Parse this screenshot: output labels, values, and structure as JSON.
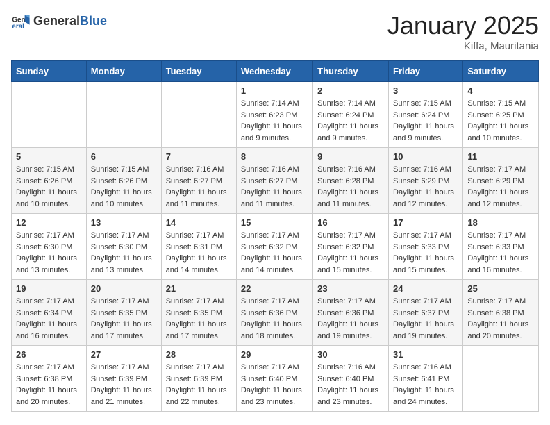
{
  "header": {
    "logo_general": "General",
    "logo_blue": "Blue",
    "month_title": "January 2025",
    "location": "Kiffa, Mauritania"
  },
  "days_of_week": [
    "Sunday",
    "Monday",
    "Tuesday",
    "Wednesday",
    "Thursday",
    "Friday",
    "Saturday"
  ],
  "weeks": [
    [
      {
        "day": "",
        "info": ""
      },
      {
        "day": "",
        "info": ""
      },
      {
        "day": "",
        "info": ""
      },
      {
        "day": "1",
        "info": "Sunrise: 7:14 AM\nSunset: 6:23 PM\nDaylight: 11 hours and 9 minutes."
      },
      {
        "day": "2",
        "info": "Sunrise: 7:14 AM\nSunset: 6:24 PM\nDaylight: 11 hours and 9 minutes."
      },
      {
        "day": "3",
        "info": "Sunrise: 7:15 AM\nSunset: 6:24 PM\nDaylight: 11 hours and 9 minutes."
      },
      {
        "day": "4",
        "info": "Sunrise: 7:15 AM\nSunset: 6:25 PM\nDaylight: 11 hours and 10 minutes."
      }
    ],
    [
      {
        "day": "5",
        "info": "Sunrise: 7:15 AM\nSunset: 6:26 PM\nDaylight: 11 hours and 10 minutes."
      },
      {
        "day": "6",
        "info": "Sunrise: 7:15 AM\nSunset: 6:26 PM\nDaylight: 11 hours and 10 minutes."
      },
      {
        "day": "7",
        "info": "Sunrise: 7:16 AM\nSunset: 6:27 PM\nDaylight: 11 hours and 11 minutes."
      },
      {
        "day": "8",
        "info": "Sunrise: 7:16 AM\nSunset: 6:27 PM\nDaylight: 11 hours and 11 minutes."
      },
      {
        "day": "9",
        "info": "Sunrise: 7:16 AM\nSunset: 6:28 PM\nDaylight: 11 hours and 11 minutes."
      },
      {
        "day": "10",
        "info": "Sunrise: 7:16 AM\nSunset: 6:29 PM\nDaylight: 11 hours and 12 minutes."
      },
      {
        "day": "11",
        "info": "Sunrise: 7:17 AM\nSunset: 6:29 PM\nDaylight: 11 hours and 12 minutes."
      }
    ],
    [
      {
        "day": "12",
        "info": "Sunrise: 7:17 AM\nSunset: 6:30 PM\nDaylight: 11 hours and 13 minutes."
      },
      {
        "day": "13",
        "info": "Sunrise: 7:17 AM\nSunset: 6:30 PM\nDaylight: 11 hours and 13 minutes."
      },
      {
        "day": "14",
        "info": "Sunrise: 7:17 AM\nSunset: 6:31 PM\nDaylight: 11 hours and 14 minutes."
      },
      {
        "day": "15",
        "info": "Sunrise: 7:17 AM\nSunset: 6:32 PM\nDaylight: 11 hours and 14 minutes."
      },
      {
        "day": "16",
        "info": "Sunrise: 7:17 AM\nSunset: 6:32 PM\nDaylight: 11 hours and 15 minutes."
      },
      {
        "day": "17",
        "info": "Sunrise: 7:17 AM\nSunset: 6:33 PM\nDaylight: 11 hours and 15 minutes."
      },
      {
        "day": "18",
        "info": "Sunrise: 7:17 AM\nSunset: 6:33 PM\nDaylight: 11 hours and 16 minutes."
      }
    ],
    [
      {
        "day": "19",
        "info": "Sunrise: 7:17 AM\nSunset: 6:34 PM\nDaylight: 11 hours and 16 minutes."
      },
      {
        "day": "20",
        "info": "Sunrise: 7:17 AM\nSunset: 6:35 PM\nDaylight: 11 hours and 17 minutes."
      },
      {
        "day": "21",
        "info": "Sunrise: 7:17 AM\nSunset: 6:35 PM\nDaylight: 11 hours and 17 minutes."
      },
      {
        "day": "22",
        "info": "Sunrise: 7:17 AM\nSunset: 6:36 PM\nDaylight: 11 hours and 18 minutes."
      },
      {
        "day": "23",
        "info": "Sunrise: 7:17 AM\nSunset: 6:36 PM\nDaylight: 11 hours and 19 minutes."
      },
      {
        "day": "24",
        "info": "Sunrise: 7:17 AM\nSunset: 6:37 PM\nDaylight: 11 hours and 19 minutes."
      },
      {
        "day": "25",
        "info": "Sunrise: 7:17 AM\nSunset: 6:38 PM\nDaylight: 11 hours and 20 minutes."
      }
    ],
    [
      {
        "day": "26",
        "info": "Sunrise: 7:17 AM\nSunset: 6:38 PM\nDaylight: 11 hours and 20 minutes."
      },
      {
        "day": "27",
        "info": "Sunrise: 7:17 AM\nSunset: 6:39 PM\nDaylight: 11 hours and 21 minutes."
      },
      {
        "day": "28",
        "info": "Sunrise: 7:17 AM\nSunset: 6:39 PM\nDaylight: 11 hours and 22 minutes."
      },
      {
        "day": "29",
        "info": "Sunrise: 7:17 AM\nSunset: 6:40 PM\nDaylight: 11 hours and 23 minutes."
      },
      {
        "day": "30",
        "info": "Sunrise: 7:16 AM\nSunset: 6:40 PM\nDaylight: 11 hours and 23 minutes."
      },
      {
        "day": "31",
        "info": "Sunrise: 7:16 AM\nSunset: 6:41 PM\nDaylight: 11 hours and 24 minutes."
      },
      {
        "day": "",
        "info": ""
      }
    ]
  ]
}
